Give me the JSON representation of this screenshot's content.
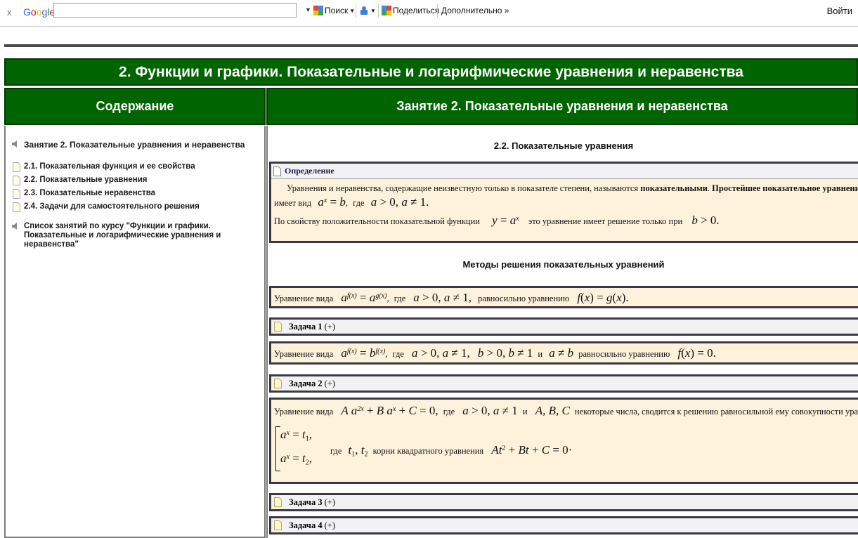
{
  "toolbar": {
    "close": "x",
    "logo": [
      "G",
      "o",
      "o",
      "g",
      "l",
      "e"
    ],
    "search_placeholder": "",
    "search_btn": "Поиск",
    "share_btn": "Поделиться",
    "more_btn": "Дополнительно »",
    "login": "Войти"
  },
  "banner": "2. Функции и графики. Показательные и логарифмические уравнения и неравенства",
  "left_header": "Содержание",
  "right_header": "Занятие 2. Показательные уравнения и неравенства",
  "sidebar": {
    "lesson": "Занятие 2. Показательные уравнения и неравенства",
    "items": [
      "2.1. Показательная функция и ее свойства",
      "2.2. Показательные уравнения",
      "2.3. Показательные неравенства",
      "2.4. Задачи для самостоятельного решения"
    ],
    "course_list": "Список занятий по курсу \"Функции и графики. Показательные и логарифмические уравнения и неравенства\""
  },
  "main": {
    "section_title": "2.2. Показательные уравнения",
    "definition_title": "Определение",
    "def_line1_a": "Уравнения и неравенства, содержащие неизвестную только в показателе степени, называются ",
    "def_line1_b": "показательными",
    "def_line1_c": ". ",
    "def_line1_d": "Простейшее показательное уравнение",
    "def_line2_a": "имеет вид",
    "def_line2_b": "где",
    "def_line3_a": "По свойству положительности показательной функции",
    "def_line3_b": "это уравнение имеет решение только при",
    "methods_title": "Методы решения показательных уравнений",
    "m1_a": "Уравнение вида",
    "m1_b": "где",
    "m1_c": "равносильно уравнению",
    "task1": "Задача 1",
    "m2_a": "Уравнение вида",
    "m2_b": "где",
    "m2_c": "и",
    "m2_d": "равносильно уравнению",
    "task2": "Задача 2",
    "m3_a": "Уравнение вида",
    "m3_b": "где",
    "m3_c": "и",
    "m3_d": "некоторые числа, сводится к решению равносильной ему совокупности уравнений",
    "m3_e": "где",
    "m3_f": "корни квадратного уравнения",
    "task3": "Задача 3",
    "task4": "Задача 4",
    "plus": "(+)"
  }
}
